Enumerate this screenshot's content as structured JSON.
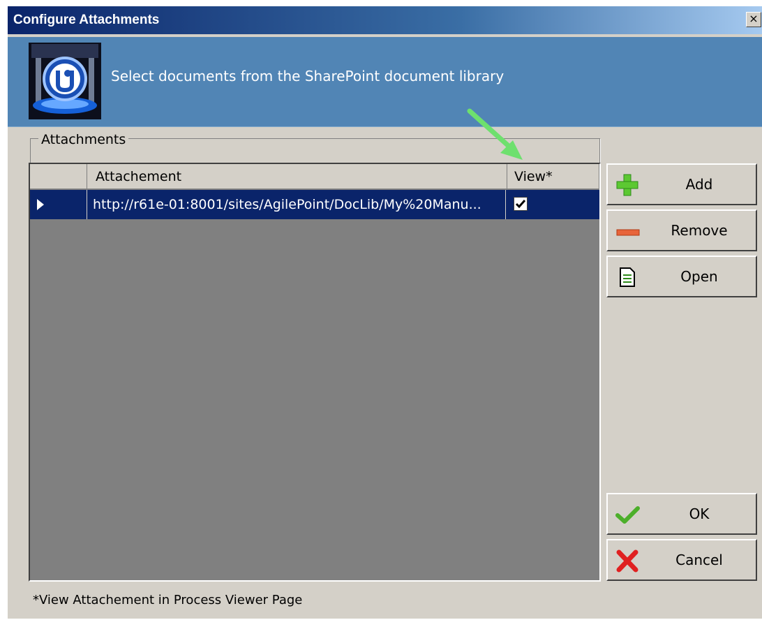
{
  "window": {
    "title": "Configure Attachments",
    "close_glyph": "×"
  },
  "header": {
    "text": "Select documents from the SharePoint document library",
    "logo_icon": "agilepoint-logo-icon"
  },
  "attachments_group": {
    "label": "Attachments"
  },
  "grid": {
    "columns": [
      "Attachement",
      "View*"
    ],
    "rows": [
      {
        "url": "http://r61e-01:8001/sites/AgilePoint/DocLib/My%20Manu...",
        "view_checked": true
      }
    ]
  },
  "buttons": {
    "add": "Add",
    "remove": "Remove",
    "open": "Open",
    "ok": "OK",
    "cancel": "Cancel"
  },
  "footer": {
    "note": "*View Attachement in Process Viewer Page"
  },
  "colors": {
    "selection": "#0a246a",
    "dialog_bg": "#d4d0c8",
    "header_band": "#5185b5",
    "annotation_arrow": "#6ee06e"
  }
}
